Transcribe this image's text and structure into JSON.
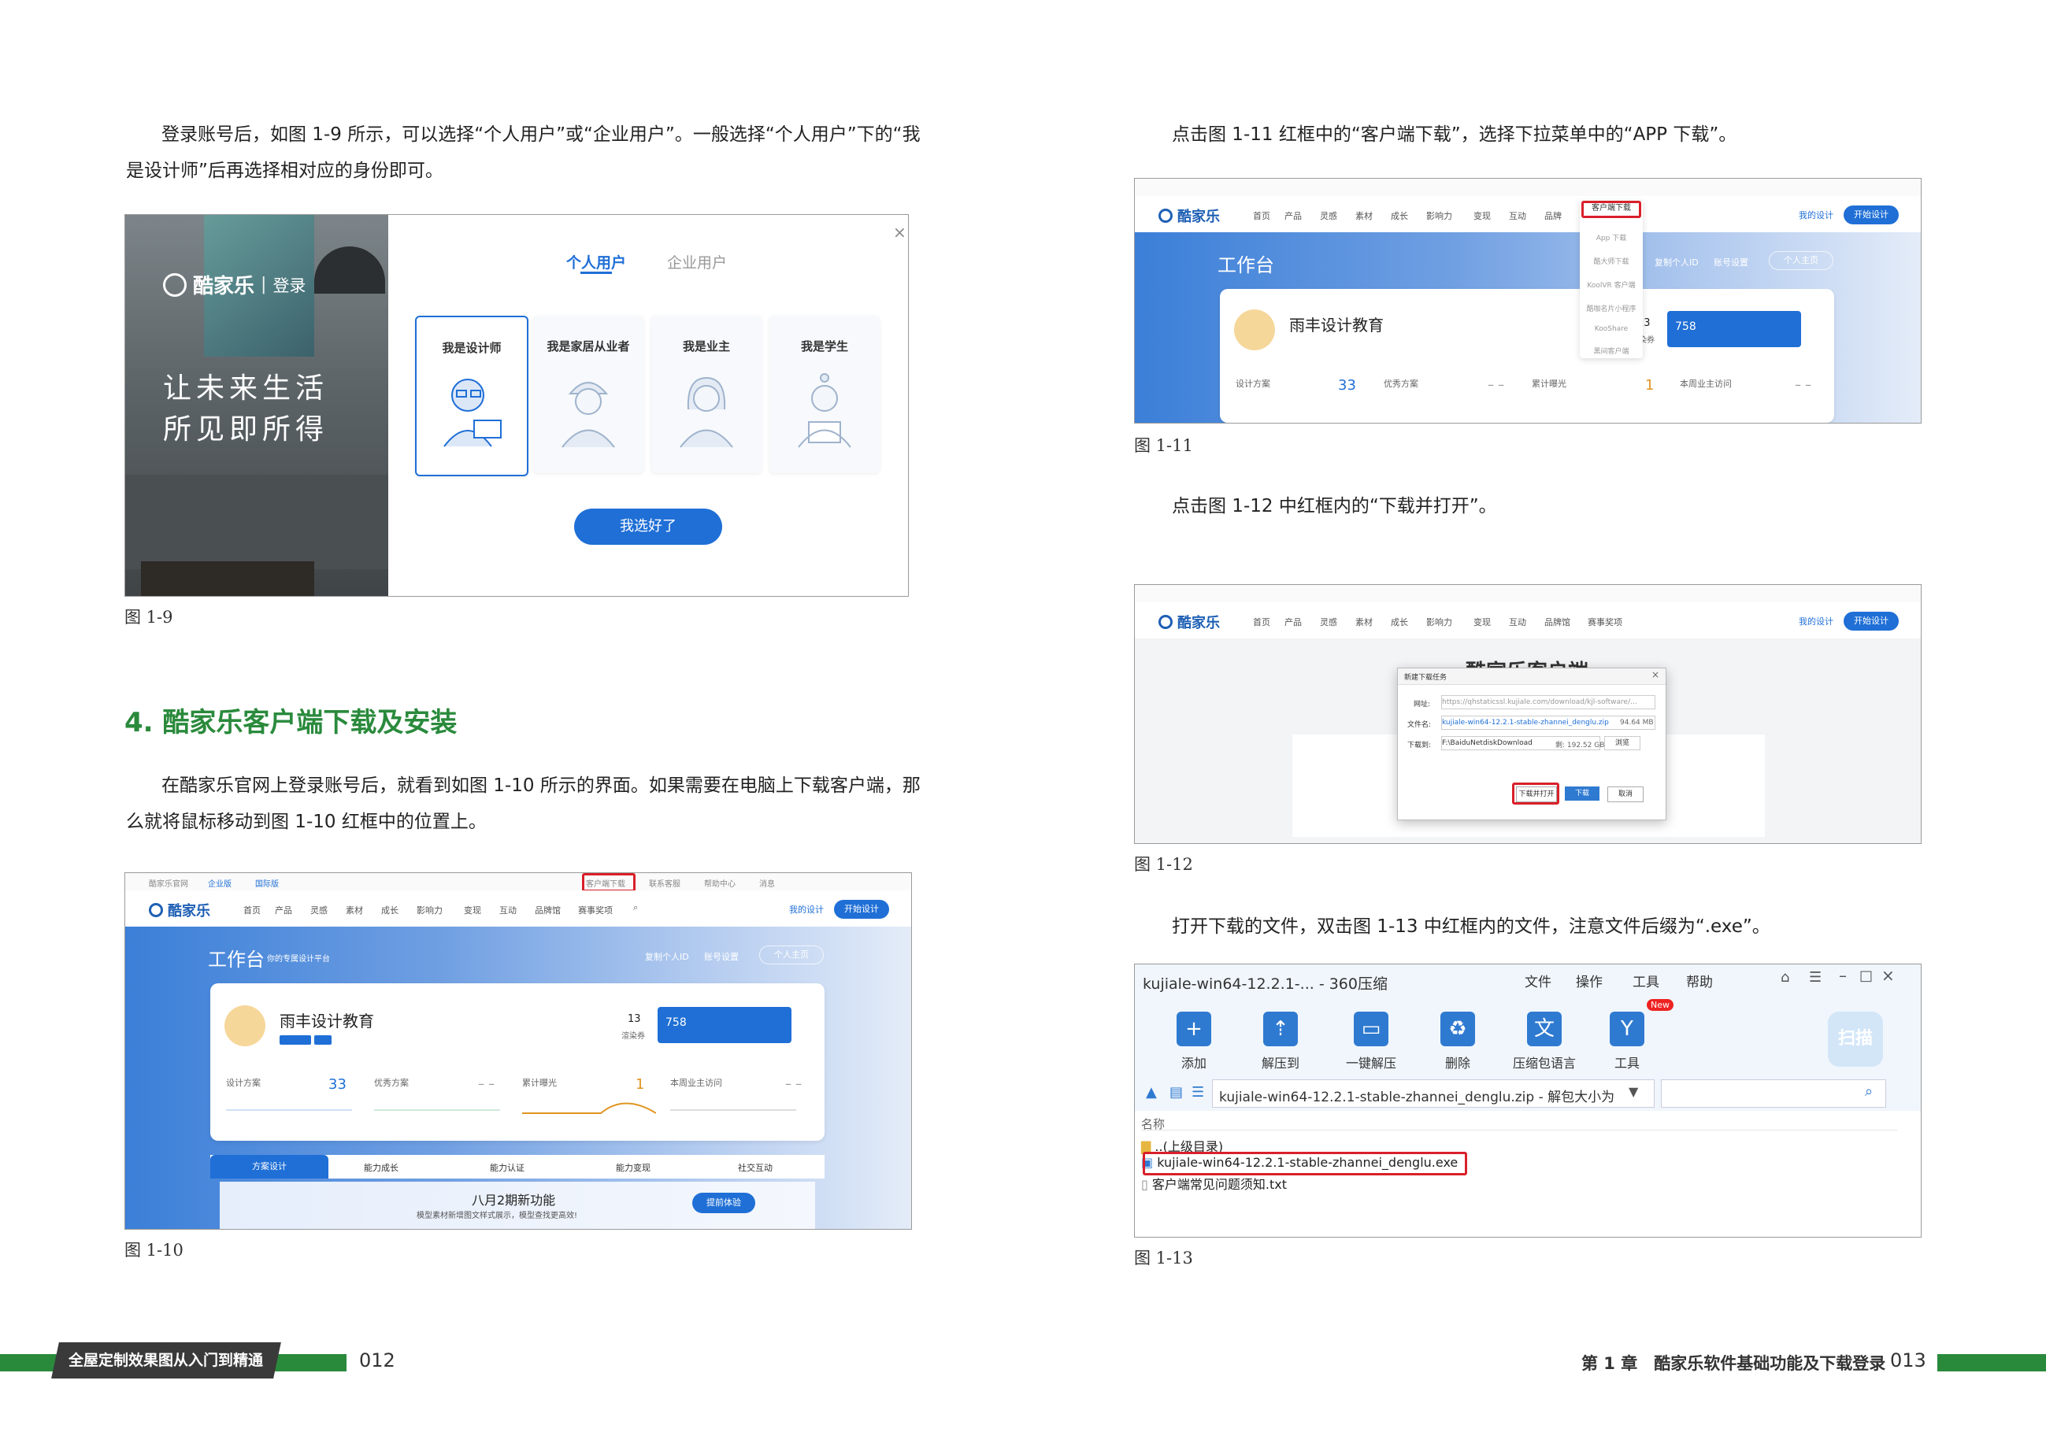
{
  "left_page": {
    "para1": [
      "登录账号后，如图 1-9 所示，可以选择“个人用户”或“企业用户”。一般选择“个人用户”下的“我",
      "是设计师”后再选择相对应的身份即可。"
    ],
    "fig9": {
      "caption": "图 1-9",
      "brand": "酷家乐",
      "login": "登录",
      "slogan1": "让未来生活",
      "slogan2": "所见即所得",
      "tab_personal": "个人用户",
      "tab_enterprise": "企业用户",
      "close": "×",
      "roles": [
        "我是设计师",
        "我是家居从业者",
        "我是业主",
        "我是学生"
      ],
      "confirm": "我选好了"
    },
    "heading": "4. 酷家乐客户端下载及安装",
    "para2": [
      "在酷家乐官网上登录账号后，就看到如图 1-10 所示的界面。如果需要在电脑上下载客户端，那",
      "么就将鼠标移动到图 1-10 红框中的位置上。"
    ],
    "fig10": {
      "caption": "图 1-10",
      "workbench": "工作台",
      "workbench_sub": "你的专属设计平台",
      "org_name": "雨丰设计教育",
      "stats": [
        {
          "label": "设计方案",
          "value": "33"
        },
        {
          "label": "优秀方案",
          "value": "– –"
        },
        {
          "label": "累计曝光",
          "value": "1"
        },
        {
          "label": "本周业主访问",
          "value": "– –"
        }
      ],
      "render_count": "13",
      "render_label": "渲染券",
      "coins": "758",
      "tabs": [
        "方案设计",
        "能力成长",
        "能力认证",
        "能力变现",
        "社交互动"
      ],
      "promo_title": "八月2期新功能",
      "promo_sub": "模型素材新增图文样式展示，模型查找更高效!",
      "promo_btn": "提前体验",
      "btn_my_design": "我的设计",
      "btn_start_design": "开始设计",
      "btn_personal": "个人主页",
      "link_account": "账号设置",
      "link_personal": "复制个人ID",
      "nav": [
        "首页",
        "产品",
        "灵感",
        "素材",
        "成长",
        "影响力",
        "变现",
        "互动",
        "品牌馆",
        "赛事奖项"
      ],
      "top_links": [
        "酷家乐官网",
        "企业版",
        "国际版",
        "客户端下载",
        "联系客服",
        "帮助中心",
        "消息"
      ],
      "logo": "酷家乐"
    },
    "footer_tab": "全屋定制效果图从入门到精通",
    "page_no": "012"
  },
  "right_page": {
    "para1": "点击图 1-11 红框中的“客户端下载”，选择下拉菜单中的“APP 下载”。",
    "fig11": {
      "caption": "图 1-11",
      "logo": "酷家乐",
      "nav": [
        "首页",
        "产品",
        "灵感",
        "素材",
        "成长",
        "影响力",
        "变现",
        "互动",
        "品牌"
      ],
      "dropdown_head": "客户端下载",
      "dropdown": [
        "App 下载",
        "酷大师下载",
        "KoolVR 客户端",
        "酷咖名片小程序",
        "KooShare",
        "黑间客户端"
      ],
      "workbench": "工作台",
      "org_name": "雨丰设计教育",
      "coins": "758",
      "render_count": "13",
      "render_label": "渲染券",
      "stats": [
        {
          "label": "设计方案",
          "value": "33"
        },
        {
          "label": "优秀方案",
          "value": "– –"
        },
        {
          "label": "累计曝光",
          "value": "1"
        },
        {
          "label": "本周业主访问",
          "value": "– –"
        }
      ],
      "btn_my_design": "我的设计",
      "btn_start_design": "开始设计",
      "btn_personal": "个人主页",
      "link_personal": "复制个人ID",
      "link_account": "账号设置"
    },
    "para2": "点击图 1-12 中红框内的“下载并打开”。",
    "fig12": {
      "caption": "图 1-12",
      "logo": "酷家乐",
      "bg_title": "酷家乐客户端",
      "dialog_title": "新建下载任务",
      "url_label": "网址:",
      "url_value": "https://qhstaticssl.kujiale.com/download/kjl-software/...",
      "name_label": "文件名:",
      "name_value": "kujiale-win64-12.2.1-stable-zhannei_denglu.zip",
      "size": "94.64 MB",
      "path_label": "下载到:",
      "path_value": "F:\\BaiduNetdiskDownload",
      "free": "剩: 192.52 GB",
      "browse": "浏览",
      "btn_open": "下载并打开",
      "btn_download": "下载",
      "btn_cancel": "取消",
      "btn_my_design": "我的设计",
      "btn_start_design": "开始设计",
      "nav": [
        "首页",
        "产品",
        "灵感",
        "素材",
        "成长",
        "影响力",
        "变现",
        "互动",
        "品牌馆",
        "赛事奖项"
      ]
    },
    "para3": "打开下载的文件，双击图 1-13 中红框内的文件，注意文件后缀为“.exe”。",
    "fig13": {
      "caption": "图 1-13",
      "title": "kujiale-win64-12.2.1-... - 360压缩",
      "menu": [
        "文件",
        "操作",
        "工具",
        "帮助"
      ],
      "tools": [
        "添加",
        "解压到",
        "一键解压",
        "删除",
        "压缩包语言",
        "工具"
      ],
      "new_badge": "New",
      "scan": "扫描",
      "path": "kujiale-win64-12.2.1-stable-zhannei_denglu.zip - 解包大小为",
      "col_name": "名称",
      "files": [
        "..(上级目录)",
        "kujiale-win64-12.2.1-stable-zhannei_denglu.exe",
        "客户端常见问题须知.txt"
      ]
    },
    "footer_chapter": "第 1 章　酷家乐软件基础功能及下载登录",
    "page_no": "013"
  }
}
